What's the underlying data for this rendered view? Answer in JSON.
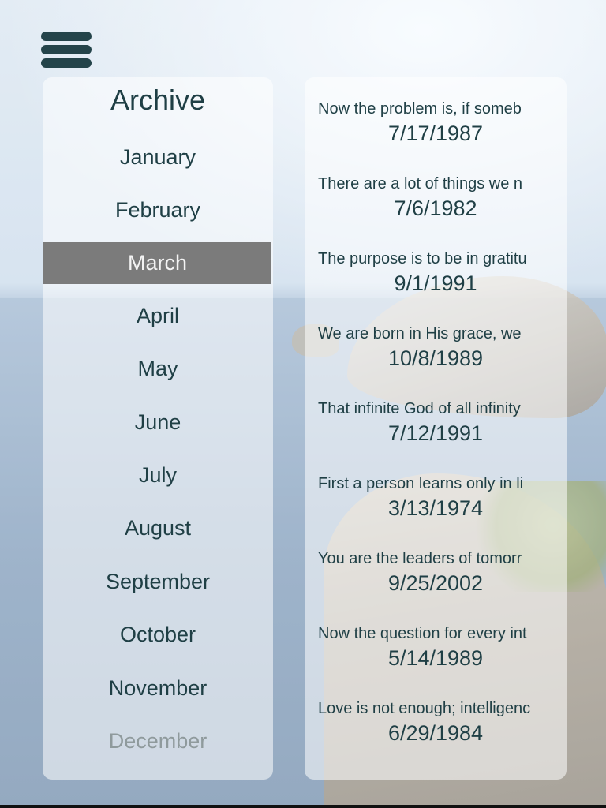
{
  "menu": {
    "icon": "hamburger-menu-icon"
  },
  "archive": {
    "title": "Archive",
    "selected_month": "March",
    "months": [
      {
        "label": "January"
      },
      {
        "label": "February"
      },
      {
        "label": "March"
      },
      {
        "label": "April"
      },
      {
        "label": "May"
      },
      {
        "label": "June"
      },
      {
        "label": "July"
      },
      {
        "label": "August"
      },
      {
        "label": "September"
      },
      {
        "label": "October"
      },
      {
        "label": "November"
      },
      {
        "label": "December"
      }
    ]
  },
  "quotes": [
    {
      "text": "Now the problem is, if someb",
      "date": "7/17/1987"
    },
    {
      "text": "There are a lot of things we n",
      "date": "7/6/1982"
    },
    {
      "text": "The purpose is to be in gratitu",
      "date": "9/1/1991"
    },
    {
      "text": "We are born in His grace, we",
      "date": "10/8/1989"
    },
    {
      "text": "That infinite God of all infinity",
      "date": "7/12/1991"
    },
    {
      "text": "First a person learns only in li",
      "date": "3/13/1974"
    },
    {
      "text": "You are the leaders of tomorr",
      "date": "9/25/2002"
    },
    {
      "text": "Now the question for every int",
      "date": "5/14/1989"
    },
    {
      "text": "Love is not enough; intelligenc",
      "date": "6/29/1984"
    }
  ],
  "colors": {
    "text": "#1f3f45",
    "selected_bg": "#7b7b7b",
    "selected_text": "#f4f4f4",
    "faded_text": "#8f9a9c"
  }
}
